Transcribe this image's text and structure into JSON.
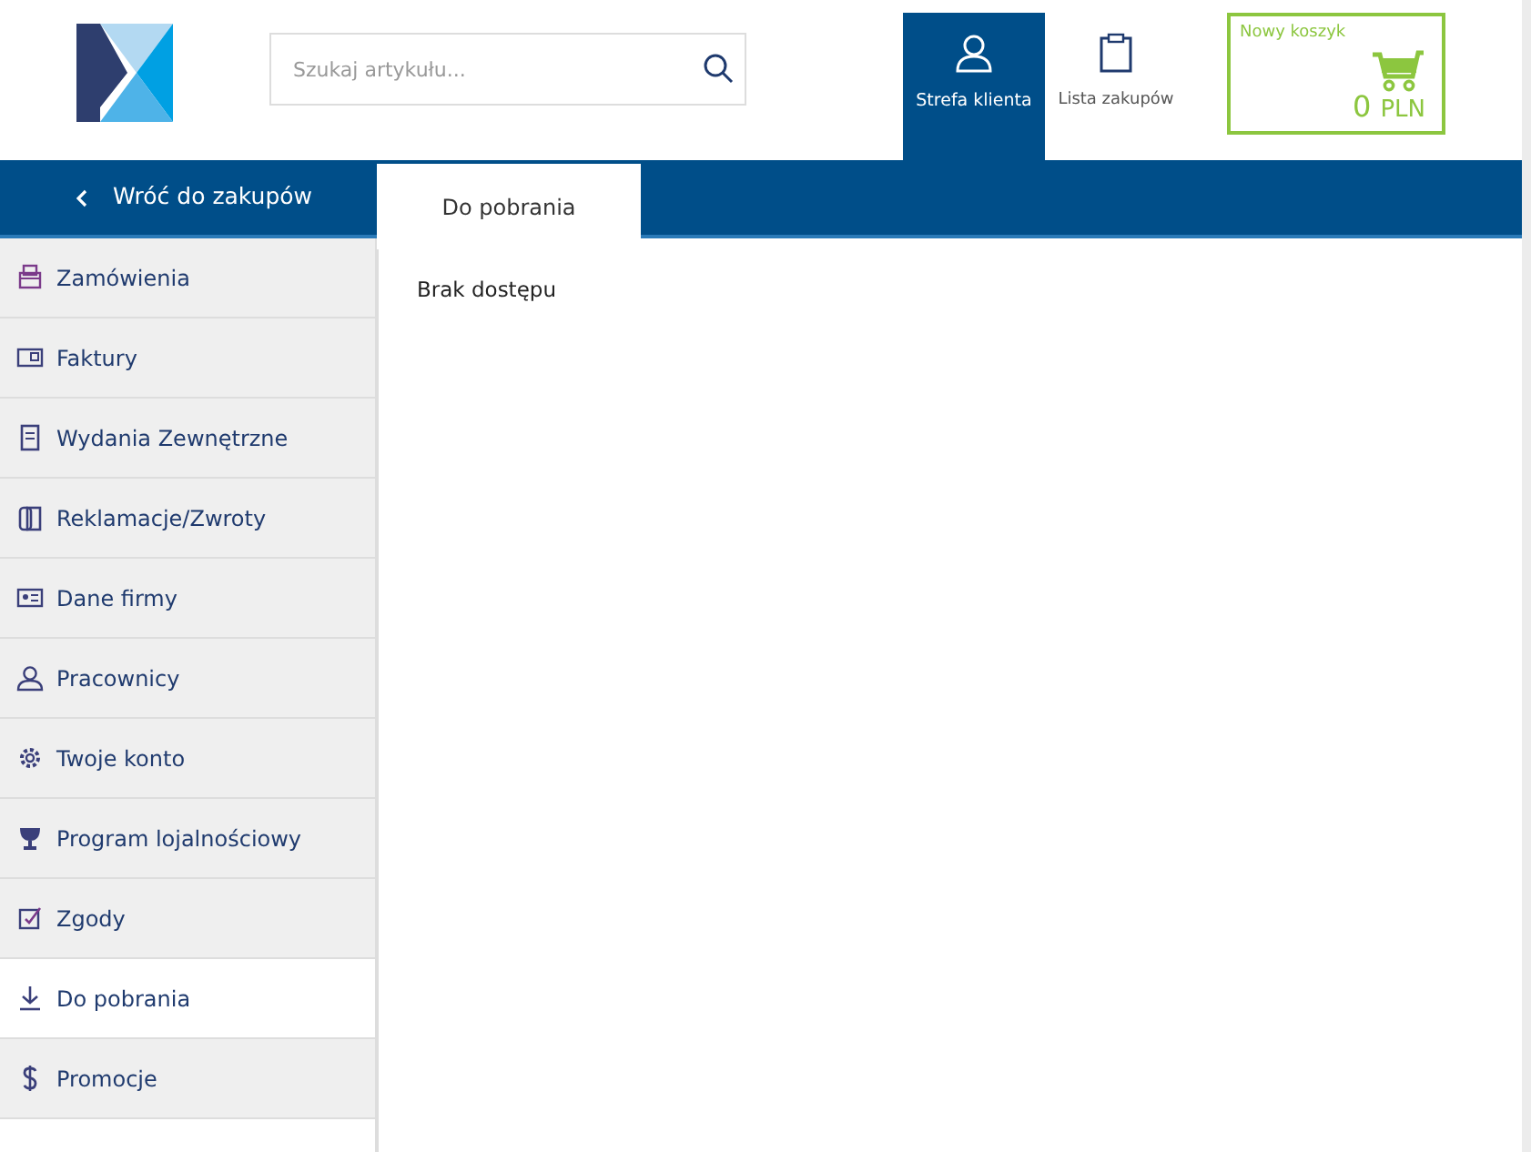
{
  "search": {
    "placeholder": "Szukaj artykułu..."
  },
  "header_nav": [
    {
      "label": "Strefa klienta",
      "selected": true
    },
    {
      "label": "Lista zakupów",
      "selected": false
    }
  ],
  "cart": {
    "title": "Nowy koszyk",
    "amount": "0",
    "currency": "PLN"
  },
  "back_link": "Wróć do zakupów",
  "tabs": [
    {
      "label": "Do pobrania",
      "selected": true
    }
  ],
  "sidebar": {
    "items": [
      {
        "label": "Zamówienia",
        "selected": false
      },
      {
        "label": "Faktury",
        "selected": false
      },
      {
        "label": "Wydania Zewnętrzne",
        "selected": false
      },
      {
        "label": "Reklamacje/Zwroty",
        "selected": false
      },
      {
        "label": "Dane firmy",
        "selected": false
      },
      {
        "label": "Pracownicy",
        "selected": false
      },
      {
        "label": "Twoje konto",
        "selected": false
      },
      {
        "label": "Program lojalnościowy",
        "selected": false
      },
      {
        "label": "Zgody",
        "selected": false
      },
      {
        "label": "Do pobrania",
        "selected": true
      },
      {
        "label": "Promocje",
        "selected": false
      }
    ]
  },
  "content": {
    "message": "Brak dostępu"
  }
}
